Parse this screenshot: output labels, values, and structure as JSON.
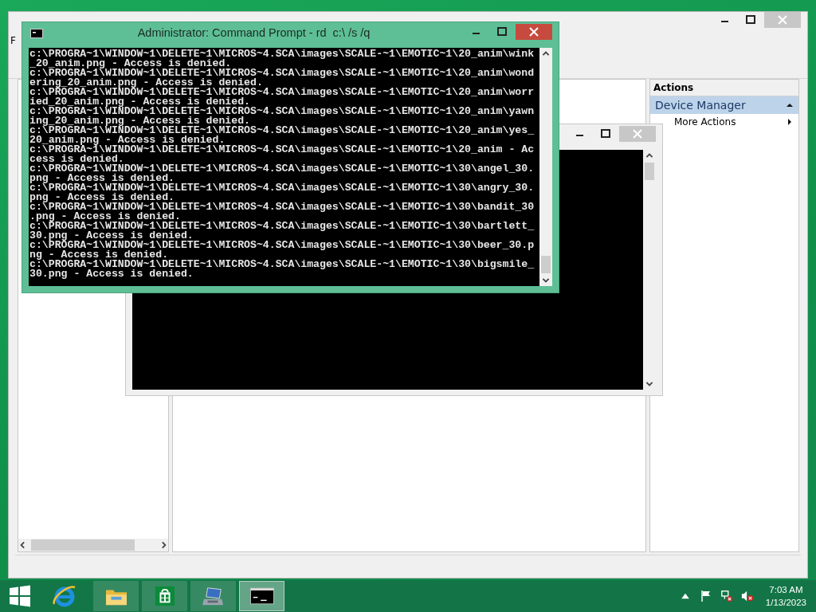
{
  "management_window": {
    "menu": [
      {
        "label": "F"
      }
    ],
    "actions_pane": {
      "header": "Actions",
      "section": {
        "title": "Device Manager",
        "expanded": true
      },
      "items": [
        {
          "label": "More Actions"
        }
      ]
    }
  },
  "console_window": {
    "title": "Administrator: Command Prompt - rd  c:\\ /s /q",
    "lines": [
      "c:\\PROGRA~1\\WINDOW~1\\DELETE~1\\MICROS~4.SCA\\images\\SCALE-~1\\EMOTIC~1\\20_anim\\wink",
      "_20_anim.png - Access is denied.",
      "c:\\PROGRA~1\\WINDOW~1\\DELETE~1\\MICROS~4.SCA\\images\\SCALE-~1\\EMOTIC~1\\20_anim\\wond",
      "ering_20_anim.png - Access is denied.",
      "c:\\PROGRA~1\\WINDOW~1\\DELETE~1\\MICROS~4.SCA\\images\\SCALE-~1\\EMOTIC~1\\20_anim\\worr",
      "ied_20_anim.png - Access is denied.",
      "c:\\PROGRA~1\\WINDOW~1\\DELETE~1\\MICROS~4.SCA\\images\\SCALE-~1\\EMOTIC~1\\20_anim\\yawn",
      "ing_20_anim.png - Access is denied.",
      "c:\\PROGRA~1\\WINDOW~1\\DELETE~1\\MICROS~4.SCA\\images\\SCALE-~1\\EMOTIC~1\\20_anim\\yes_",
      "20_anim.png - Access is denied.",
      "c:\\PROGRA~1\\WINDOW~1\\DELETE~1\\MICROS~4.SCA\\images\\SCALE-~1\\EMOTIC~1\\20_anim - Ac",
      "cess is denied.",
      "c:\\PROGRA~1\\WINDOW~1\\DELETE~1\\MICROS~4.SCA\\images\\SCALE-~1\\EMOTIC~1\\30\\angel_30.",
      "png - Access is denied.",
      "c:\\PROGRA~1\\WINDOW~1\\DELETE~1\\MICROS~4.SCA\\images\\SCALE-~1\\EMOTIC~1\\30\\angry_30.",
      "png - Access is denied.",
      "c:\\PROGRA~1\\WINDOW~1\\DELETE~1\\MICROS~4.SCA\\images\\SCALE-~1\\EMOTIC~1\\30\\bandit_30",
      ".png - Access is denied.",
      "c:\\PROGRA~1\\WINDOW~1\\DELETE~1\\MICROS~4.SCA\\images\\SCALE-~1\\EMOTIC~1\\30\\bartlett_",
      "30.png - Access is denied.",
      "c:\\PROGRA~1\\WINDOW~1\\DELETE~1\\MICROS~4.SCA\\images\\SCALE-~1\\EMOTIC~1\\30\\beer_30.p",
      "ng - Access is denied.",
      "c:\\PROGRA~1\\WINDOW~1\\DELETE~1\\MICROS~4.SCA\\images\\SCALE-~1\\EMOTIC~1\\30\\bigsmile_",
      "30.png - Access is denied."
    ]
  },
  "taskbar": {
    "apps": [
      {
        "kind": "explorer",
        "selected": false
      },
      {
        "kind": "store",
        "selected": false
      },
      {
        "kind": "management",
        "selected": false
      },
      {
        "kind": "console",
        "selected": true
      }
    ],
    "clock": {
      "time": "7:03 AM",
      "date": "1/13/2023"
    }
  }
}
